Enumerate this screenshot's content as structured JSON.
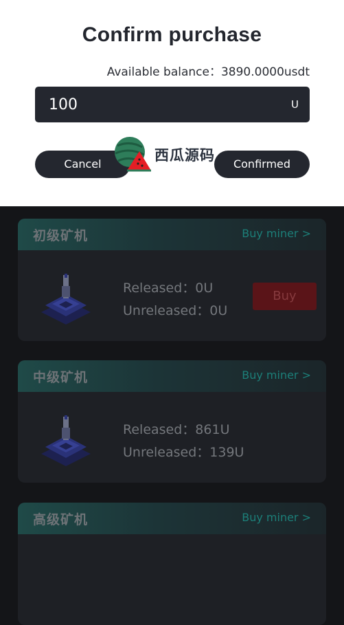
{
  "modal": {
    "title": "Confirm purchase",
    "balance_text": "Available balance：3890.0000usdt",
    "amount_value": "100",
    "amount_unit": "U",
    "cancel_label": "Cancel",
    "confirm_label": "Confirmed"
  },
  "watermark": {
    "text": "西瓜源码"
  },
  "cards": [
    {
      "title": "初级矿机",
      "link": "Buy miner >",
      "released": "Released：0U",
      "unreleased": "Unreleased：0U",
      "buy_label": "Buy"
    },
    {
      "title": "中级矿机",
      "link": "Buy miner >",
      "released": "Released：861U",
      "unreleased": "Unreleased：139U"
    },
    {
      "title": "高级矿机",
      "link": "Buy miner >"
    }
  ],
  "colors": {
    "modal_bg": "#ffffff",
    "dark_button": "#24272f",
    "page_bg": "#141518",
    "card_bg": "#1e2025",
    "link_teal": "#1c7f79",
    "buy_red": "#5a1418"
  }
}
